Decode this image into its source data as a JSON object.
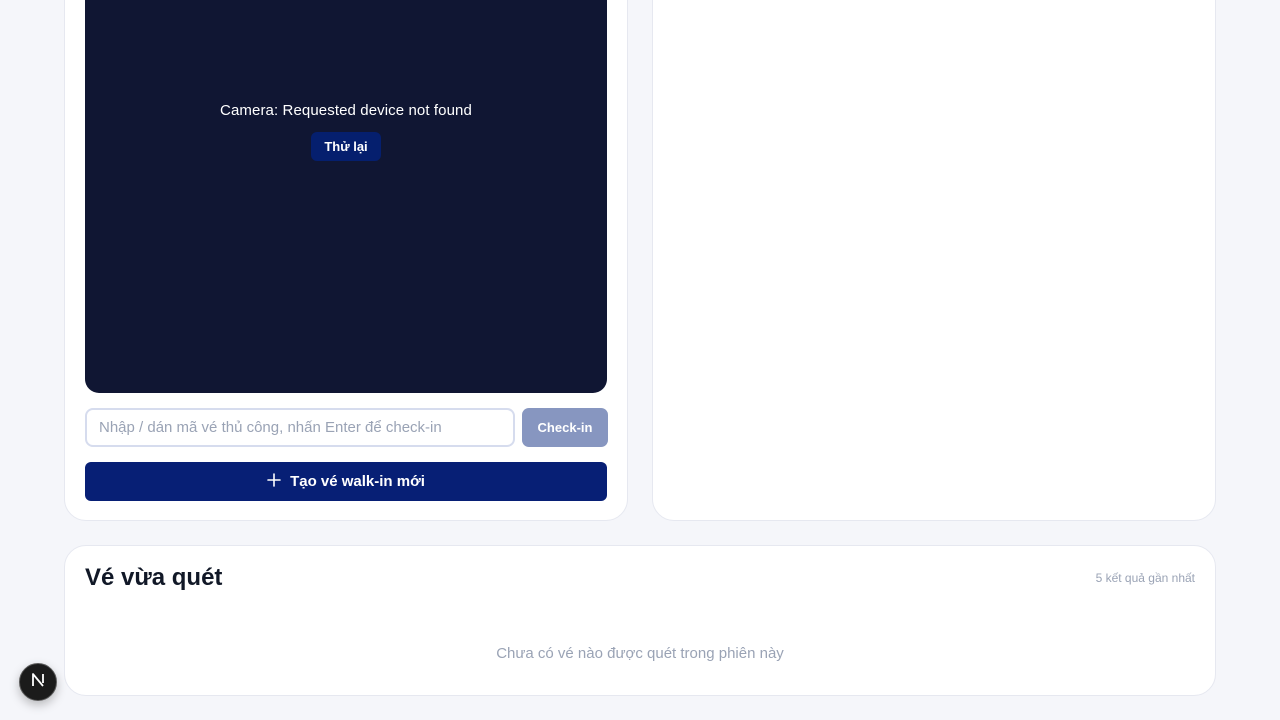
{
  "scanner": {
    "camera_message": "Camera: Requested device not found",
    "retry_label": "Thử lại",
    "input_placeholder": "Nhập / dán mã vé thủ công, nhấn Enter để check-in",
    "input_value": "",
    "checkin_label": "Check-in",
    "walkin_label": "Tạo vé walk-in mới",
    "walkin_icon": "plus-icon"
  },
  "recent": {
    "title": "Vé vừa quét",
    "count_label": "5 kết quả gần nhất",
    "empty_message": "Chưa có vé nào được quét trong phiên này"
  },
  "dev_badge": {
    "icon": "nextjs-logo-icon"
  },
  "colors": {
    "primary": "#071f75",
    "camera_bg": "#101633",
    "disabled_button": "#8796c0",
    "muted_text": "#9aa3b5",
    "page_bg": "#f5f6fa"
  }
}
